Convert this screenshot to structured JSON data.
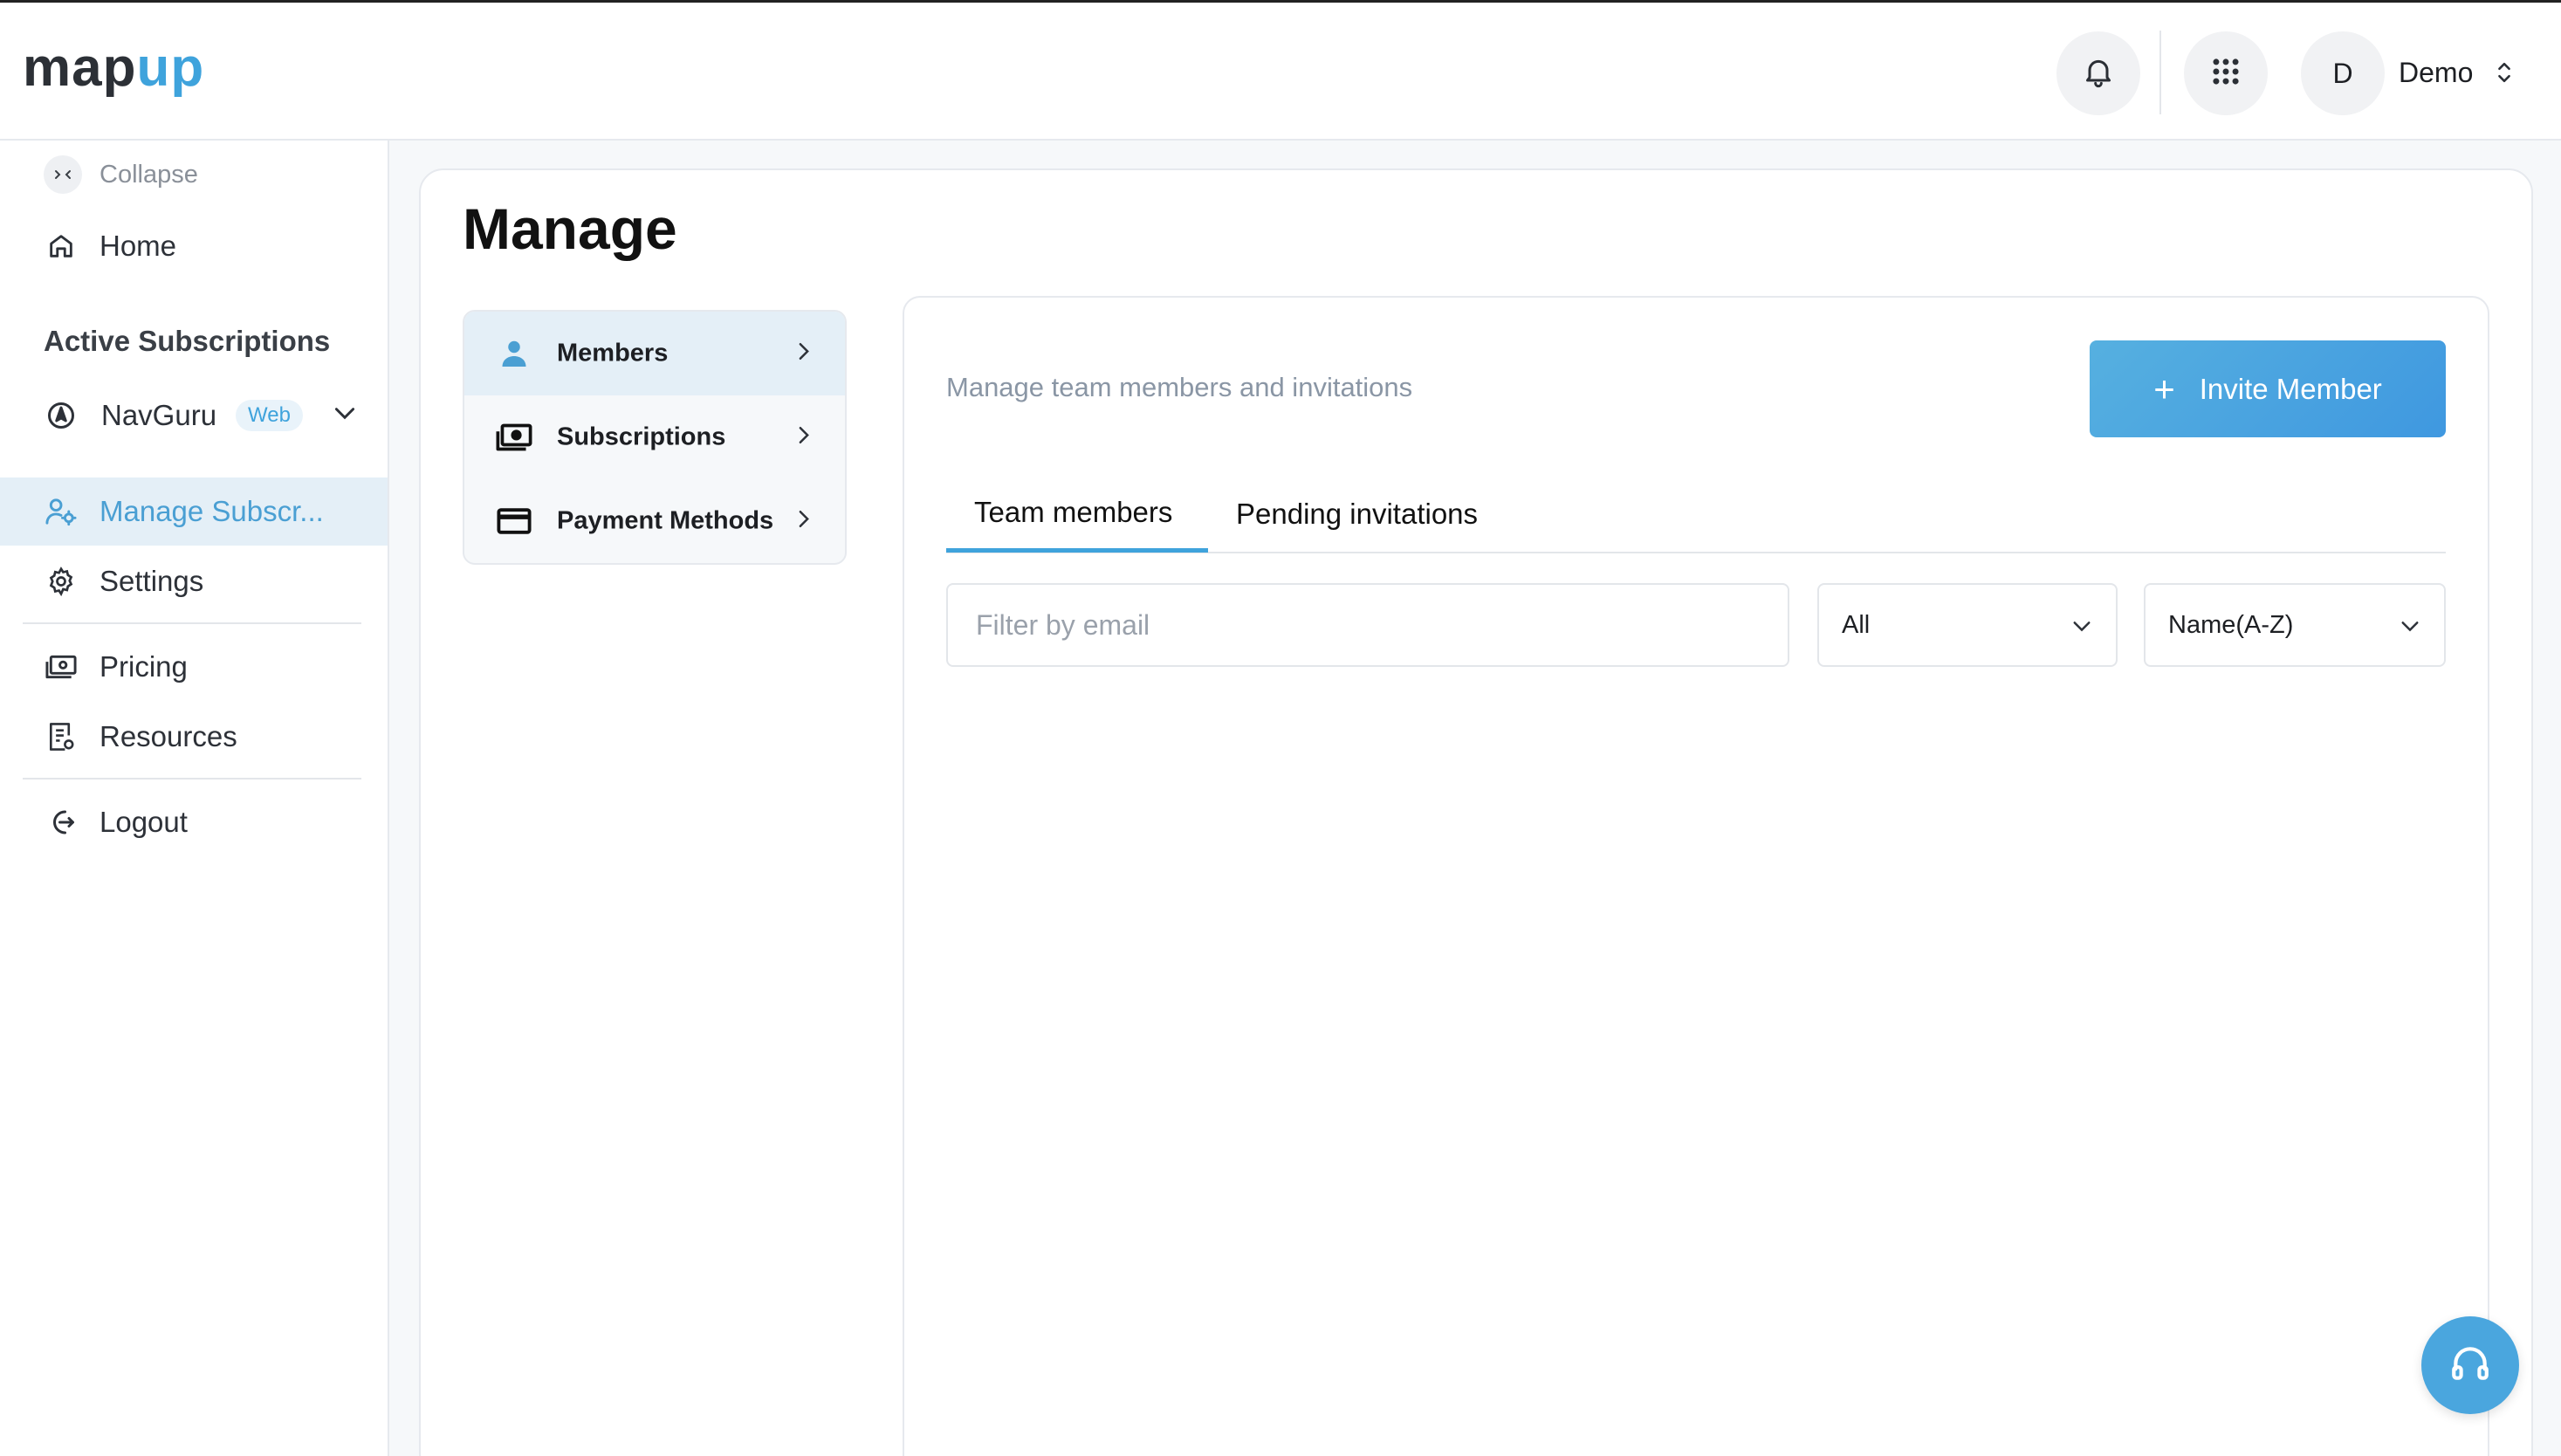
{
  "brand": {
    "logo_part1": "map",
    "logo_part2": "up"
  },
  "header": {
    "avatar_initial": "D",
    "user_name": "Demo",
    "icons": [
      "bell-icon",
      "apps-grid-icon",
      "chevron-updown-icon"
    ]
  },
  "sidebar": {
    "collapse_label": "Collapse",
    "home_label": "Home",
    "section_title": "Active Subscriptions",
    "subscription": {
      "label": "NavGuru",
      "badge": "Web"
    },
    "items": {
      "manage": "Manage Subscr...",
      "settings": "Settings",
      "pricing": "Pricing",
      "resources": "Resources",
      "logout": "Logout"
    }
  },
  "main": {
    "title": "Manage",
    "submenu": [
      {
        "label": "Members",
        "active": true
      },
      {
        "label": "Subscriptions",
        "active": false
      },
      {
        "label": "Payment Methods",
        "active": false
      }
    ],
    "subtitle": "Manage team members and invitations",
    "invite_button": {
      "plus": "+",
      "label": "Invite Member"
    },
    "tabs": [
      {
        "label": "Team members",
        "active": true
      },
      {
        "label": "Pending invitations",
        "active": false
      }
    ],
    "filter": {
      "placeholder": "Filter by email",
      "value": ""
    },
    "status_select": {
      "value": "All"
    },
    "sort_select": {
      "value": "Name(A-Z)"
    }
  },
  "colors": {
    "accent": "#3fa3dc",
    "active_bg": "#e4eff7",
    "button_start": "#56b0e0",
    "button_end": "#3f98e0"
  }
}
